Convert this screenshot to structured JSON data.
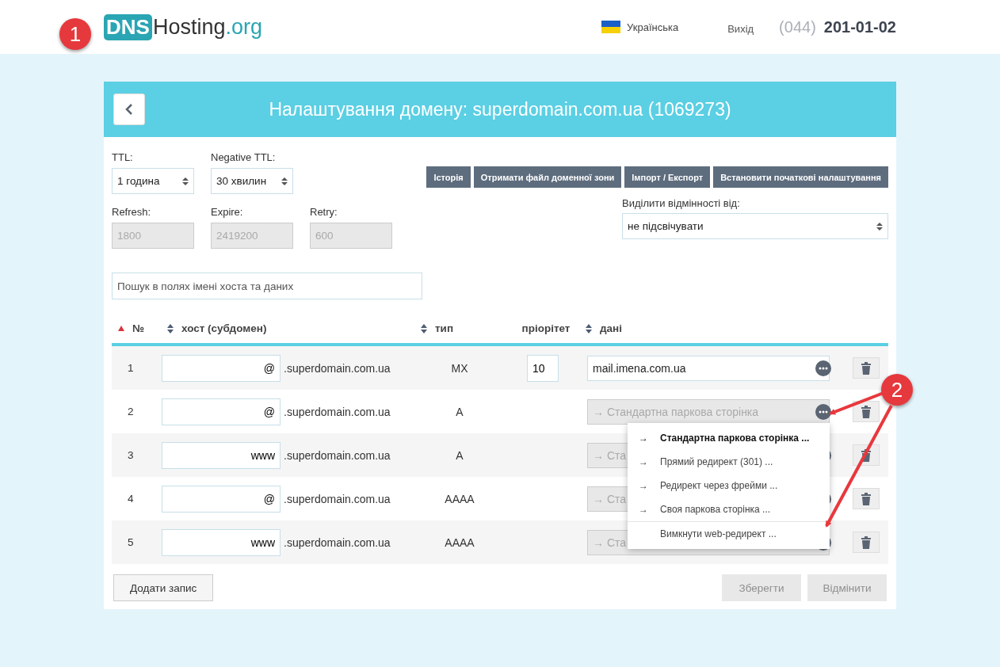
{
  "header": {
    "logo": {
      "badge": "DNS",
      "name": "Hosting",
      "suffix": ".org"
    },
    "language": "Українська",
    "logout": "Вихід",
    "phone_code": "(044)",
    "phone": "201-01-02"
  },
  "panel": {
    "title": "Налаштування домену: superdomain.com.ua (1069273)",
    "ttl": {
      "label": "TTL:",
      "value": "1 година"
    },
    "negative_ttl": {
      "label": "Negative TTL:",
      "value": "30 хвилин"
    },
    "actions": [
      "Історія",
      "Отримати файл доменної зони",
      "Імпорт / Експорт",
      "Встановити початкові налаштування"
    ],
    "diff": {
      "label": "Виділити відмінності від:",
      "value": "не підсвічувати"
    },
    "fixed_fields": [
      {
        "label": "Refresh:",
        "value": "1800",
        "disabled": true
      },
      {
        "label": "Expire:",
        "value": "2419200",
        "disabled": true
      },
      {
        "label": "Retry:",
        "value": "600",
        "disabled": true
      }
    ],
    "search": {
      "placeholder": "Пошук в полях імені хоста та даних"
    },
    "columns": [
      {
        "label": "№",
        "sortable": true,
        "sorted": true
      },
      {
        "label": "хост (субдомен)",
        "sortable": true,
        "sorted": false
      },
      {
        "label": "тип",
        "sortable": true,
        "sorted": false
      },
      {
        "label": "пріорітет",
        "sortable": false,
        "sorted": false
      },
      {
        "label": "дані",
        "sortable": true,
        "sorted": false
      }
    ],
    "rows": [
      {
        "number": "1",
        "host": "@",
        "domain": ".superdomain.com.ua",
        "type": "MX",
        "priority": "10",
        "data": "mail.imena.com.ua",
        "disabled": false
      },
      {
        "number": "2",
        "host": "@",
        "domain": ".superdomain.com.ua",
        "type": "A",
        "data": "→ Стандартна паркова сторінка",
        "disabled": true
      },
      {
        "number": "3",
        "host": "www",
        "domain": ".superdomain.com.ua",
        "type": "A",
        "data": "→ Ста",
        "disabled": true
      },
      {
        "number": "4",
        "host": "@",
        "domain": ".superdomain.com.ua",
        "type": "AAAA",
        "data": "→ Ста",
        "disabled": true
      },
      {
        "number": "5",
        "host": "www",
        "domain": ".superdomain.com.ua",
        "type": "AAAA",
        "data": "→ Ста",
        "disabled": true
      }
    ],
    "menu": [
      {
        "arrow": "→",
        "label": "Стандартна паркова сторінка ...",
        "selected": true,
        "kind": "redirect"
      },
      {
        "arrow": "→",
        "label": "Прямий редирект (301) ...",
        "selected": false,
        "kind": "redirect"
      },
      {
        "arrow": "→",
        "label": "Редирект через фрейми ...",
        "selected": false,
        "kind": "redirect"
      },
      {
        "arrow": "→",
        "label": "Своя паркова сторінка ...",
        "selected": false,
        "kind": "redirect"
      },
      {
        "label": "Вимкнути web-редирект ...",
        "selected": false,
        "kind": "action"
      }
    ],
    "add_button": "Додати запис",
    "save_button": {
      "label": "Зберегти",
      "disabled": true
    },
    "cancel_button": {
      "label": "Відмінити",
      "disabled": true
    }
  },
  "annotations": [
    {
      "label": "1"
    },
    {
      "label": "2"
    }
  ]
}
